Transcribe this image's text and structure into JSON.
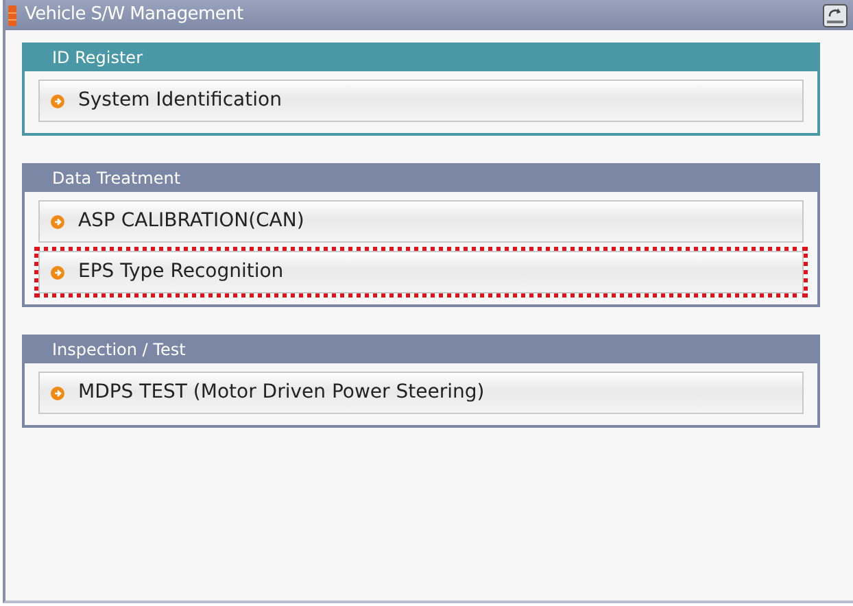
{
  "window": {
    "title": "Vehicle S/W Management"
  },
  "sections": [
    {
      "title": "ID Register",
      "color": "#4a97a6",
      "items": [
        {
          "label": "System Identification",
          "selected": false
        }
      ]
    },
    {
      "title": "Data Treatment",
      "color": "#7b87a4",
      "items": [
        {
          "label": "ASP CALIBRATION(CAN)",
          "selected": false
        },
        {
          "label": "EPS Type Recognition",
          "selected": true
        }
      ]
    },
    {
      "title": "Inspection / Test",
      "color": "#7b87a4",
      "items": [
        {
          "label": "MDPS TEST (Motor Driven Power Steering)",
          "selected": false
        }
      ]
    }
  ]
}
